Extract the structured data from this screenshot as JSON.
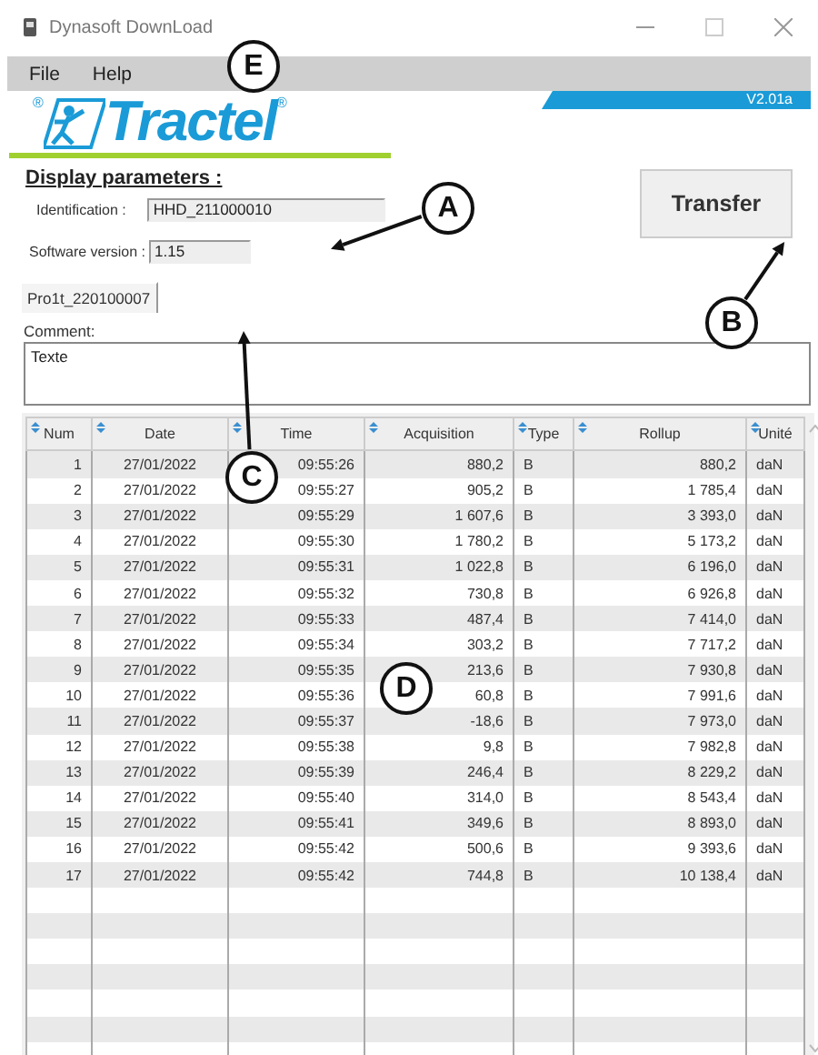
{
  "window": {
    "title": "Dynasoft DownLoad"
  },
  "menu": [
    {
      "label": "File"
    },
    {
      "label": "Help"
    }
  ],
  "logo": {
    "text": "Tractel",
    "mark_left": "®",
    "mark_right": "®"
  },
  "version": "V2.01a",
  "display_parameters": {
    "heading": "Display parameters :",
    "fields": [
      {
        "label": "Identification :",
        "value": "HHD_211000010"
      },
      {
        "label": "Software version :",
        "value": "1.15"
      }
    ]
  },
  "transfer_button": "Transfer",
  "tabs": [
    {
      "label": "Pro1t_220100007",
      "selected": true
    }
  ],
  "comment": {
    "label": "Comment:",
    "value": "Texte"
  },
  "table": {
    "columns": [
      "Num",
      "Date",
      "Time",
      "Acquisition",
      "Type",
      "Rollup",
      "Unité"
    ],
    "rows": [
      [
        "1",
        "27/01/2022",
        "09:55:26",
        "880,2",
        "B",
        "880,2",
        "daN"
      ],
      [
        "2",
        "27/01/2022",
        "09:55:27",
        "905,2",
        "B",
        "1 785,4",
        "daN"
      ],
      [
        "3",
        "27/01/2022",
        "09:55:29",
        "1 607,6",
        "B",
        "3 393,0",
        "daN"
      ],
      [
        "4",
        "27/01/2022",
        "09:55:30",
        "1 780,2",
        "B",
        "5 173,2",
        "daN"
      ],
      [
        "5",
        "27/01/2022",
        "09:55:31",
        "1 022,8",
        "B",
        "6 196,0",
        "daN"
      ],
      [
        "6",
        "27/01/2022",
        "09:55:32",
        "730,8",
        "B",
        "6 926,8",
        "daN"
      ],
      [
        "7",
        "27/01/2022",
        "09:55:33",
        "487,4",
        "B",
        "7 414,0",
        "daN"
      ],
      [
        "8",
        "27/01/2022",
        "09:55:34",
        "303,2",
        "B",
        "7 717,2",
        "daN"
      ],
      [
        "9",
        "27/01/2022",
        "09:55:35",
        "213,6",
        "B",
        "7 930,8",
        "daN"
      ],
      [
        "10",
        "27/01/2022",
        "09:55:36",
        "60,8",
        "B",
        "7 991,6",
        "daN"
      ],
      [
        "11",
        "27/01/2022",
        "09:55:37",
        "-18,6",
        "B",
        "7 973,0",
        "daN"
      ],
      [
        "12",
        "27/01/2022",
        "09:55:38",
        "9,8",
        "B",
        "7 982,8",
        "daN"
      ],
      [
        "13",
        "27/01/2022",
        "09:55:39",
        "246,4",
        "B",
        "8 229,2",
        "daN"
      ],
      [
        "14",
        "27/01/2022",
        "09:55:40",
        "314,0",
        "B",
        "8 543,4",
        "daN"
      ],
      [
        "15",
        "27/01/2022",
        "09:55:41",
        "349,6",
        "B",
        "8 893,0",
        "daN"
      ],
      [
        "16",
        "27/01/2022",
        "09:55:42",
        "500,6",
        "B",
        "9 393,6",
        "daN"
      ],
      [
        "17",
        "27/01/2022",
        "09:55:42",
        "744,8",
        "B",
        "10 138,4",
        "daN"
      ]
    ]
  },
  "callouts": [
    {
      "label": "E"
    },
    {
      "label": "A"
    },
    {
      "label": "B"
    },
    {
      "label": "C"
    },
    {
      "label": "D"
    }
  ]
}
